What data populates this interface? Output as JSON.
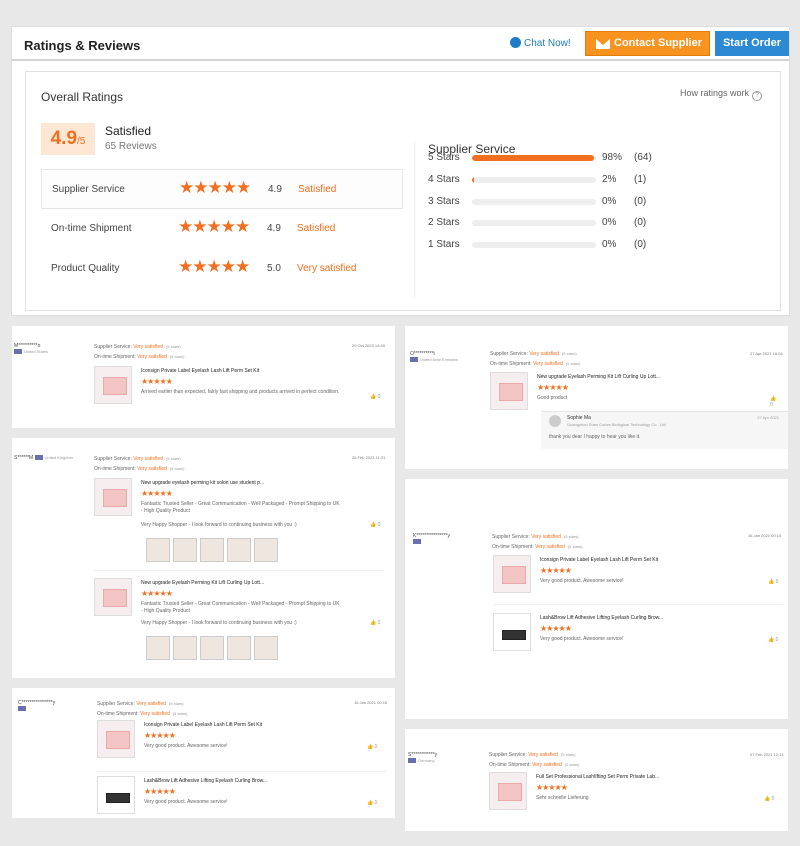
{
  "header": {
    "title": "Ratings & Reviews",
    "chat": "Chat Now!",
    "contact": "Contact Supplier",
    "order": "Start Order"
  },
  "overall": {
    "title": "Overall Ratings",
    "how": "How ratings work",
    "score": "4.9",
    "scale": "/5",
    "label": "Satisfied",
    "reviews": "65 Reviews",
    "rows": [
      {
        "label": "Supplier Service",
        "score": "4.9",
        "text": "Satisfied"
      },
      {
        "label": "On-time Shipment",
        "score": "4.9",
        "text": "Satisfied"
      },
      {
        "label": "Product Quality",
        "score": "5.0",
        "text": "Very satisfied"
      }
    ]
  },
  "supplier_service": {
    "title": "Supplier Service",
    "rows": [
      {
        "label": "5 Stars",
        "pct": "98%",
        "count": "(64)",
        "fill": 0.98
      },
      {
        "label": "4 Stars",
        "pct": "2%",
        "count": "(1)",
        "fill": 0.02
      },
      {
        "label": "3 Stars",
        "pct": "0%",
        "count": "(0)",
        "fill": 0
      },
      {
        "label": "2 Stars",
        "pct": "0%",
        "count": "(0)",
        "fill": 0
      },
      {
        "label": "1 Stars",
        "pct": "0%",
        "count": "(0)",
        "fill": 0
      }
    ]
  },
  "labels": {
    "ss": "Supplier Service:",
    "os": "On-time Shipment:",
    "vs": "Very satisfied",
    "five": "(5 stars)",
    "stars": "★★★★★",
    "zero": "0"
  },
  "reviews": [
    {
      "user": "M**********o",
      "country": "United States",
      "date": "20 Oct 2023 14:40",
      "p1": "Iconsign Private Label Eyelash Lash Lift Perm Set Kit",
      "c1": "Arrived earlier than expected, fairly fast shipping and products arrived in perfect condition."
    },
    {
      "user": "S******M",
      "country": "United Kingdom",
      "date": "26 Feb 2023 11:31",
      "p1": "New upgrade eyelash perming kit solon use student p...",
      "c1": "Fantastic Trusted Seller - Great Communication - Well Packaged - Prompt Shipping to UK - High Quality Product",
      "c1b": "Very Happy Shopper - I look forward to continuing business with you :)",
      "p2": "New upgrade Eyelash Perming Kit Lift Curling Up Lott...",
      "c2": "Fantastic Trusted Seller - Great Communication - Well Packaged - Prompt Shipping to UK - High Quality Product",
      "c2b": "Very Happy Shopper - I look forward to continuing business with you :)"
    },
    {
      "user": "C****************y",
      "date": "16 Jan 2021 00:15",
      "p1": "Iconsign Private Label Eyelash Lash Lift Perm Set Kit",
      "c1": "Very good product. Awesome service!",
      "p2": "Lash&Brow Lift Adhesive Lifting Eyelash Curling Brow...",
      "c2": "Very good product. Awesome service!"
    },
    {
      "user": "O**********t",
      "country": "United Arab Emirates",
      "date": "27 Apr 2021 16:04",
      "p1": "New upgrade Eyelash Perming Kit Lift Curling Up Lott...",
      "c1": "Good product",
      "reply_name": "Sophie Ma",
      "reply_co": "Guangzhou Stars Colors Biological Technology Co., Ltd",
      "reply_date": "27 Apr 2021",
      "reply_text": "thank you dear I happy to hear you like it."
    },
    {
      "user": "K****************y",
      "date": "16 Jan 2021 00:15",
      "p1": "Iconsign Private Label Eyelash Lash Lift Perm Set Kit",
      "c1": "Very good product. Awesome service!",
      "p2": "Lash&Brow Lift Adhesive Lifting Eyelash Curling Brow...",
      "c2": "Very good product. Awesome service!"
    },
    {
      "user": "S************y",
      "country": "Germany",
      "date": "07 Feb 2021 12:14",
      "p1": "Full Set Professional LashlIfting Set Perm Private Lab...",
      "c1": "Sehr schnelle Lieferung"
    }
  ],
  "colors": {
    "accent": "#f36f20",
    "blue": "#2b8ad3",
    "contact": "#f7931e"
  }
}
